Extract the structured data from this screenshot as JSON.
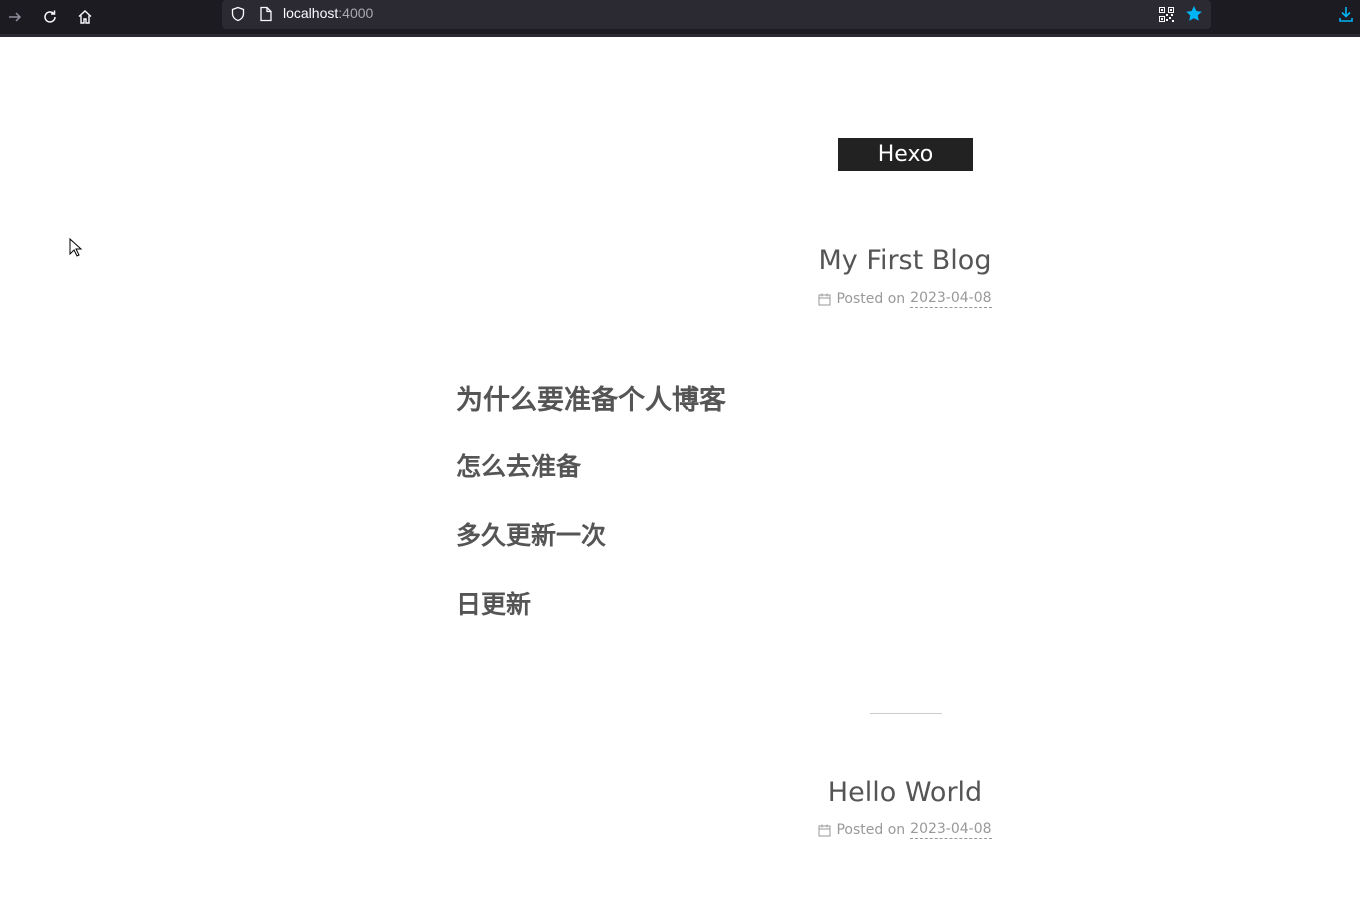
{
  "browser": {
    "url_host": "localhost",
    "url_port": ":4000",
    "star_color": "#00b3f4",
    "download_color": "#00b3f4"
  },
  "site": {
    "brand": "Hexo"
  },
  "posts": [
    {
      "title": "My First Blog",
      "posted_label": "Posted on",
      "date": "2023-04-08",
      "headings": [
        "为什么要准备个人博客",
        "怎么去准备",
        "多久更新一次",
        "日更新"
      ]
    },
    {
      "title": "Hello World",
      "posted_label": "Posted on",
      "date": "2023-04-08"
    }
  ]
}
